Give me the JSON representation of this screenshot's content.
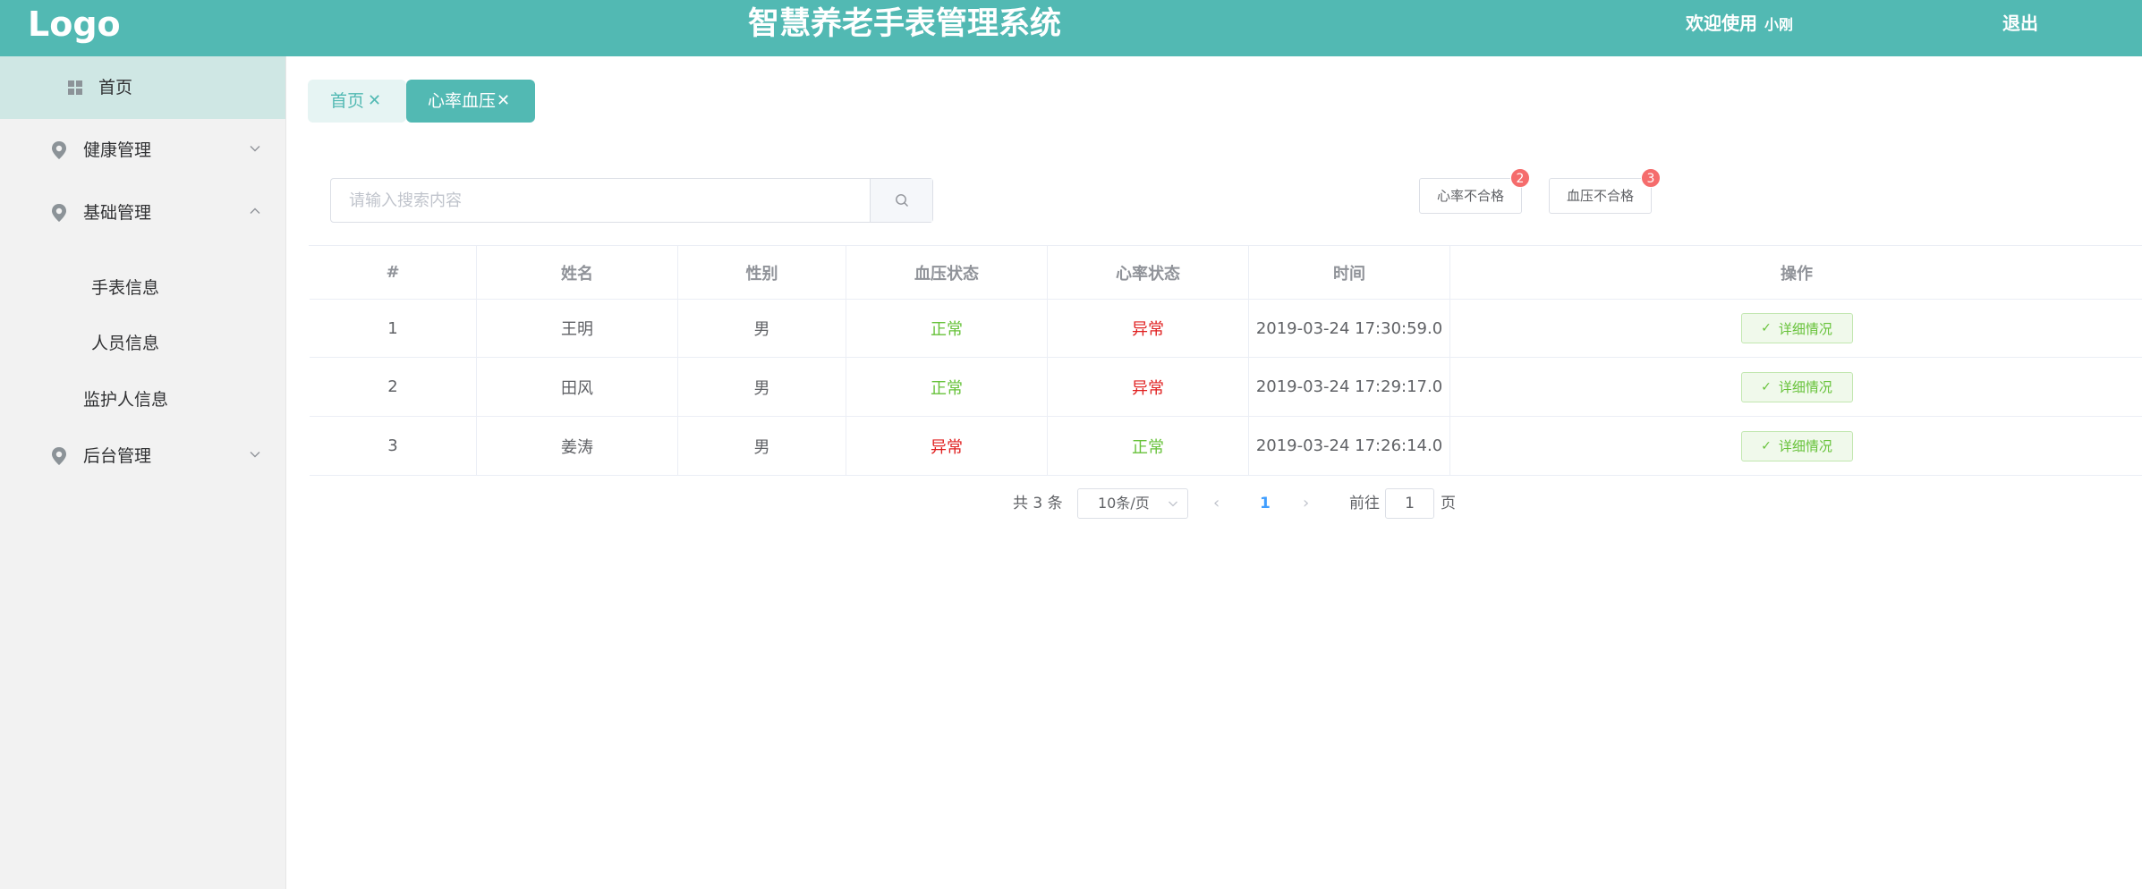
{
  "header": {
    "logo": "Logo",
    "title": "智慧养老手表管理系统",
    "welcome": "欢迎使用",
    "username": "小刚",
    "logout": "退出",
    "color": "#52b9b3"
  },
  "sidebar": {
    "home": "首页",
    "groups": [
      {
        "label": "健康管理",
        "icon": "location-pin-icon",
        "expanded": false
      },
      {
        "label": "基础管理",
        "icon": "location-pin-icon",
        "expanded": true
      },
      {
        "label": "后台管理",
        "icon": "location-pin-icon",
        "expanded": false
      }
    ],
    "sub_items": [
      "手表信息",
      "人员信息",
      "监护人信息"
    ]
  },
  "tabs": [
    {
      "label": "首页",
      "active": false
    },
    {
      "label": "心率血压",
      "active": true
    }
  ],
  "search": {
    "placeholder": "请输入搜索内容",
    "value": ""
  },
  "filters": [
    {
      "label": "心率不合格",
      "badge": "2"
    },
    {
      "label": "血压不合格",
      "badge": "3"
    }
  ],
  "table": {
    "headers": [
      "#",
      "姓名",
      "性别",
      "血压状态",
      "心率状态",
      "时间",
      "操作"
    ],
    "rows": [
      {
        "index": "1",
        "name": "王明",
        "gender": "男",
        "bp": "正常",
        "hr": "异常",
        "time": "2019-03-24 17:30:59.0",
        "action": "详细情况"
      },
      {
        "index": "2",
        "name": "田风",
        "gender": "男",
        "bp": "正常",
        "hr": "异常",
        "time": "2019-03-24 17:29:17.0",
        "action": "详细情况"
      },
      {
        "index": "3",
        "name": "姜涛",
        "gender": "男",
        "bp": "异常",
        "hr": "正常",
        "time": "2019-03-24 17:26:14.0",
        "action": "详细情况"
      }
    ],
    "status_colors": {
      "normal": "#67c23a",
      "abnormal": "#e02020"
    }
  },
  "pagination": {
    "total": "共 3 条",
    "page_size": "10条/页",
    "current_page": "1",
    "goto_prefix": "前往",
    "goto_value": "1",
    "goto_suffix": "页"
  }
}
